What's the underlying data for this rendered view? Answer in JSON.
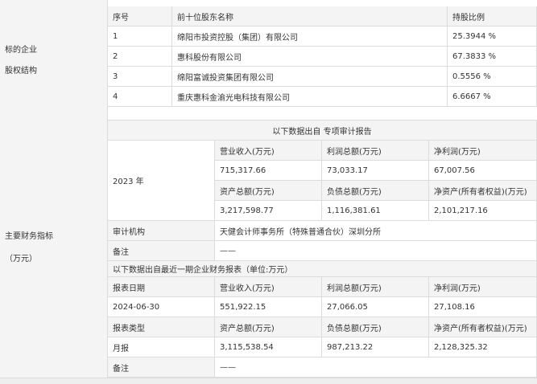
{
  "shareholding": {
    "label_line1": "标的企业",
    "label_line2": "股权结构",
    "headers": {
      "no": "序号",
      "name": "前十位股东名称",
      "ratio": "持股比例"
    },
    "rows": [
      {
        "no": "1",
        "name": "绵阳市投资控股（集团）有限公司",
        "ratio": "25.3944 %"
      },
      {
        "no": "2",
        "name": "惠科股份有限公司",
        "ratio": "67.3833 %"
      },
      {
        "no": "3",
        "name": "绵阳富诚投资集团有限公司",
        "ratio": "0.5556 %"
      },
      {
        "no": "4",
        "name": "重庆惠科金渝光电科技有限公司",
        "ratio": "6.6667 %"
      }
    ]
  },
  "financial": {
    "label_line1": "主要财务指标",
    "label_line2": "（万元）",
    "audit_section_title": "以下数据出自 专项审计报告",
    "audit_year": "2023 年",
    "h_revenue": "营业收入(万元)",
    "h_profit": "利润总额(万元)",
    "h_net_profit": "净利润(万元)",
    "h_assets": "资产总额(万元)",
    "h_liabilities": "负债总额(万元)",
    "h_net_assets": "净资产(所有者权益)(万元)",
    "audit_revenue": "715,317.66",
    "audit_profit": "73,033.17",
    "audit_net_profit": "67,007.56",
    "audit_assets": "3,217,598.77",
    "audit_liabilities": "1,116,381.61",
    "audit_net_assets": "2,101,217.16",
    "audit_org_label": "审计机构",
    "audit_org_value": "天健会计师事务所（特殊普通合伙）深圳分所",
    "remark_label": "备注",
    "remark_value": "——",
    "recent_section_title": "以下数据出自最近一期企业财务报表（单位:万元）",
    "report_date_label": "报表日期",
    "report_date_value": "2024-06-30",
    "recent_revenue": "551,922.15",
    "recent_profit": "27,066.05",
    "recent_net_profit": "27,108.16",
    "report_type_label": "报表类型",
    "report_type_value": "月报",
    "recent_assets": "3,115,538.54",
    "recent_liabilities": "987,213.22",
    "recent_net_assets": "2,128,325.32",
    "recent_remark_value": "——"
  }
}
